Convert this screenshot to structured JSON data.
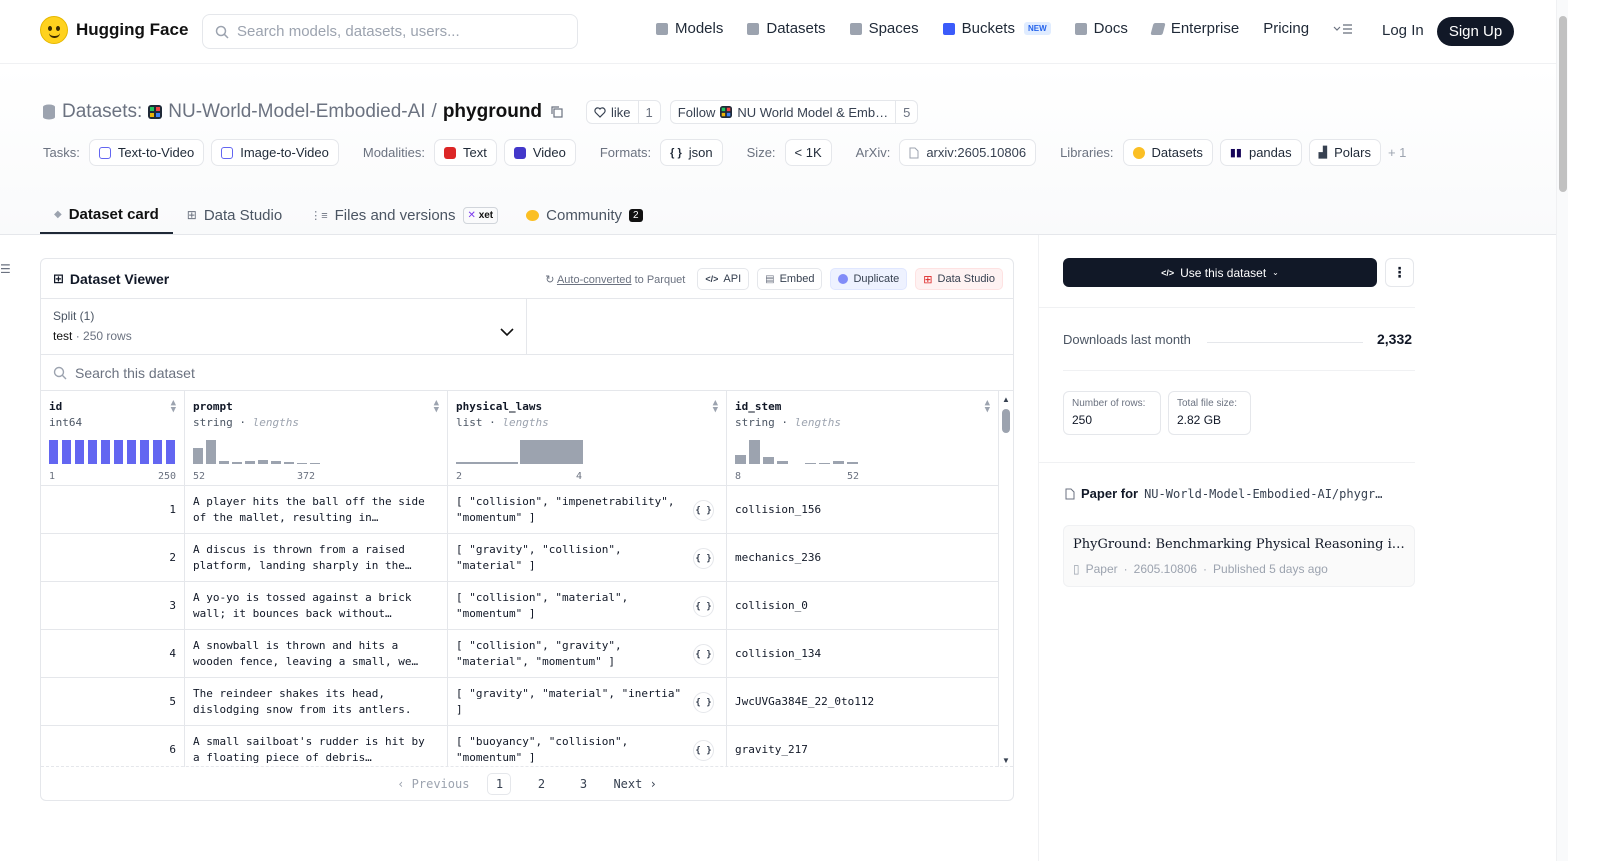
{
  "header": {
    "brand": "Hugging Face",
    "search_placeholder": "Search models, datasets, users...",
    "nav": [
      "Models",
      "Datasets",
      "Spaces",
      "Buckets",
      "Docs",
      "Enterprise",
      "Pricing"
    ],
    "new_badge": "NEW",
    "login": "Log In",
    "signup": "Sign Up"
  },
  "repo": {
    "prefix": "Datasets:",
    "org": "NU-World-Model-Embodied-AI",
    "sep": "/",
    "name": "phyground",
    "like_label": "like",
    "like_count": "1",
    "follow_label": "Follow",
    "follow_org": "NU World Model & Emb…",
    "follow_count": "5"
  },
  "tags": {
    "tasks_label": "Tasks:",
    "tasks": [
      "Text-to-Video",
      "Image-to-Video"
    ],
    "modalities_label": "Modalities:",
    "modalities": [
      "Text",
      "Video"
    ],
    "formats_label": "Formats:",
    "formats": [
      "json"
    ],
    "size_label": "Size:",
    "size": "< 1K",
    "arxiv_label": "ArXiv:",
    "arxiv": "arxiv:2605.10806",
    "libraries_label": "Libraries:",
    "libraries": [
      "Datasets",
      "pandas",
      "Polars"
    ],
    "more": "+ 1"
  },
  "tabs": {
    "card": "Dataset card",
    "studio": "Data Studio",
    "files": "Files and versions",
    "xet": "xet",
    "community": "Community",
    "community_count": "2"
  },
  "viewer": {
    "title": "Dataset Viewer",
    "auto_link": "Auto-converted",
    "auto_rest": " to Parquet",
    "buttons": [
      "API",
      "Embed",
      "Duplicate",
      "Data Studio"
    ],
    "split_label": "Split (1)",
    "split_name": "test",
    "split_rows": "250 rows",
    "search_placeholder": "Search this dataset",
    "columns": [
      {
        "name": "id",
        "type": "int64",
        "hint": "",
        "min": "1",
        "max": "250"
      },
      {
        "name": "prompt",
        "type": "string",
        "hint": "lengths",
        "min": "52",
        "max": "372"
      },
      {
        "name": "physical_laws",
        "type": "list",
        "hint": "lengths",
        "min": "2",
        "max": "4"
      },
      {
        "name": "id_stem",
        "type": "string",
        "hint": "lengths",
        "min": "8",
        "max": "52"
      }
    ],
    "rows": [
      {
        "id": "1",
        "prompt": "A player hits the ball off the side of the mallet, resulting in…",
        "laws": "[ \"collision\", \"impenetrability\", \"momentum\" ]",
        "stem": "collision_156"
      },
      {
        "id": "2",
        "prompt": "A discus is thrown from a raised platform, landing sharply in the…",
        "laws": "[ \"gravity\", \"collision\", \"material\" ]",
        "stem": "mechanics_236"
      },
      {
        "id": "3",
        "prompt": "A yo-yo is tossed against a brick wall; it bounces back without…",
        "laws": "[ \"collision\", \"material\", \"momentum\" ]",
        "stem": "collision_0"
      },
      {
        "id": "4",
        "prompt": "A snowball is thrown and hits a wooden fence, leaving a small, we…",
        "laws": "[ \"collision\", \"gravity\", \"material\", \"momentum\" ]",
        "stem": "collision_134"
      },
      {
        "id": "5",
        "prompt": "The reindeer shakes its head, dislodging snow from its antlers.",
        "laws": "[ \"gravity\", \"material\", \"inertia\" ]",
        "stem": "JwcUVGa384E_22_0to112"
      },
      {
        "id": "6",
        "prompt": "A small sailboat's rudder is hit by a floating piece of debris…",
        "laws": "[ \"buoyancy\", \"collision\", \"momentum\" ]",
        "stem": "gravity_217"
      }
    ],
    "pager": {
      "prev": "Previous",
      "pages": [
        "1",
        "2",
        "3"
      ],
      "next": "Next"
    }
  },
  "sidebar": {
    "use_button": "Use this dataset",
    "downloads_label": "Downloads last month",
    "downloads_value": "2,332",
    "rows_label": "Number of rows:",
    "rows_value": "250",
    "size_label": "Total file size:",
    "size_value": "2.82 GB",
    "paper_label": "Paper for",
    "paper_repo": "NU-World-Model-Embodied-AI/phygr…",
    "paper_title": "PhyGround: Benchmarking Physical Reasoning in Video Generation",
    "paper_type": "Paper",
    "paper_id": "2605.10806",
    "paper_published": "Published 5 days ago"
  }
}
